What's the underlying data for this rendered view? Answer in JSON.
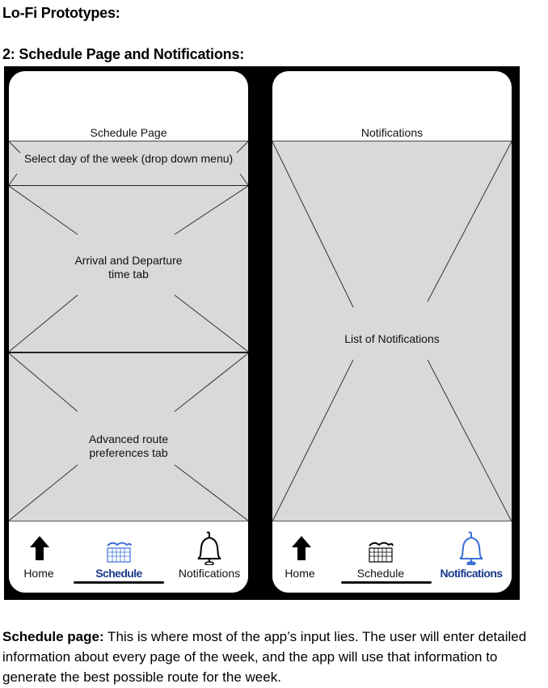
{
  "headings": {
    "title": "Lo-Fi Prototypes:",
    "subtitle": "2: Schedule Page and Notifications:"
  },
  "schedule_phone": {
    "title": "Schedule Page",
    "dropdown": "Select day of the week (drop down menu)",
    "section1": [
      "Arrival and Departure",
      "time  tab"
    ],
    "section2": [
      "Advanced route",
      "preferences tab"
    ]
  },
  "notifications_phone": {
    "title": "Notifications",
    "section": "List of Notifications"
  },
  "nav": {
    "home": "Home",
    "schedule": "Schedule",
    "notifications": "Notifications",
    "active_color": "#1a3a8c",
    "icons": [
      "up-arrow-icon",
      "calendar-icon",
      "bell-icon"
    ]
  },
  "description": {
    "label": "Schedule page:",
    "text": " This is where most of  the app’s input lies. The user will enter detailed information about every page of the week, and the app will use that information to generate the best  possible route for the week."
  },
  "colors": {
    "frame": "#000000",
    "placeholder": "#d9d9d9",
    "active_tab": "#1a3a8c",
    "icon_blue": "#3b6fd8"
  }
}
